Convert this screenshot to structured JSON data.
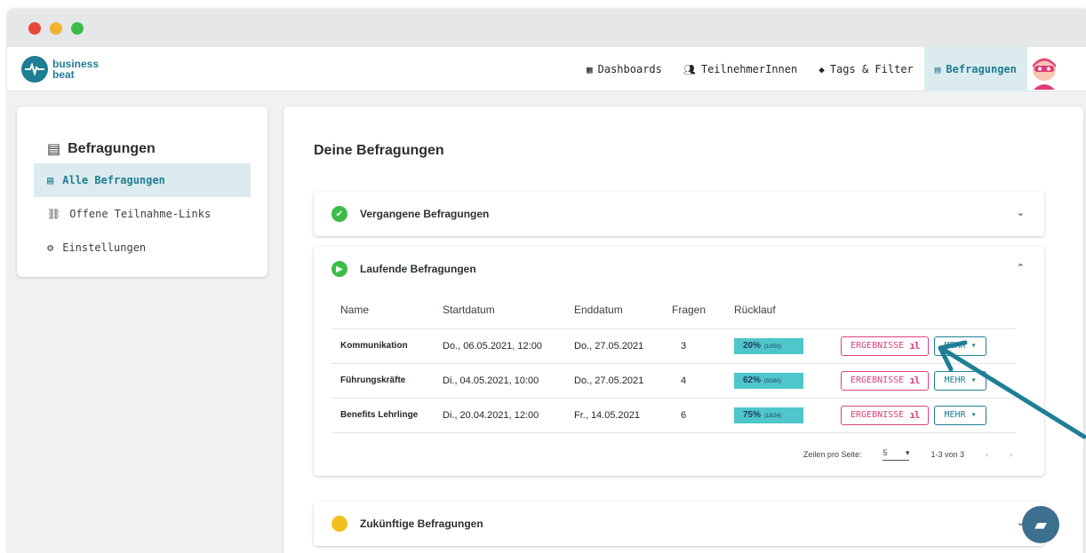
{
  "brand": {
    "line1": "business",
    "line2": "beat"
  },
  "nav": [
    {
      "icon": "dashboard-icon",
      "label": "Dashboards"
    },
    {
      "icon": "users-icon",
      "label": "TeilnehmerInnen"
    },
    {
      "icon": "tag-icon",
      "label": "Tags & Filter"
    },
    {
      "icon": "survey-icon",
      "label": "Befragungen"
    }
  ],
  "sidebar": {
    "title": "Befragungen",
    "items": [
      {
        "icon": "document-icon",
        "label": "Alle Befragungen"
      },
      {
        "icon": "link-icon",
        "label": "Offene Teilnahme-Links"
      },
      {
        "icon": "gear-icon",
        "label": "Einstellungen"
      }
    ]
  },
  "main": {
    "title": "Deine Befragungen",
    "panels": {
      "past": "Vergangene Befragungen",
      "running": "Laufende Befragungen",
      "future": "Zukünftige Befragungen"
    },
    "table": {
      "headers": [
        "Name",
        "Startdatum",
        "Enddatum",
        "Fragen",
        "Rücklauf"
      ],
      "rows": [
        {
          "name": "Kommunikation",
          "start": "Do., 06.05.2021, 12:00",
          "end": "Do., 27.05.2021",
          "fragen": "3",
          "ruecklauf": "20%",
          "ruecklauf_detail": "(10/50)",
          "ruecklauf_fraction": 0.2
        },
        {
          "name": "Führungskräfte",
          "start": "Di., 04.05.2021, 10:00",
          "end": "Do., 27.05.2021",
          "fragen": "4",
          "ruecklauf": "62%",
          "ruecklauf_detail": "(50/80)",
          "ruecklauf_fraction": 0.62
        },
        {
          "name": "Benefits Lehrlinge",
          "start": "Di., 20.04.2021, 12:00",
          "end": "Fr., 14.05.2021",
          "fragen": "6",
          "ruecklauf": "75%",
          "ruecklauf_detail": "(18/24)",
          "ruecklauf_fraction": 0.75
        }
      ],
      "btn_results": "ERGEBNISSE",
      "btn_more": "MEHR"
    },
    "pager": {
      "label": "Zeilen pro Seite:",
      "value": "5",
      "range": "1-3 von 3"
    }
  },
  "colors": {
    "teal": "#1f7e94",
    "pink": "#d9447a",
    "green": "#3dbb4a",
    "yellow": "#f2c01e",
    "badge": "#4fc5cc"
  }
}
